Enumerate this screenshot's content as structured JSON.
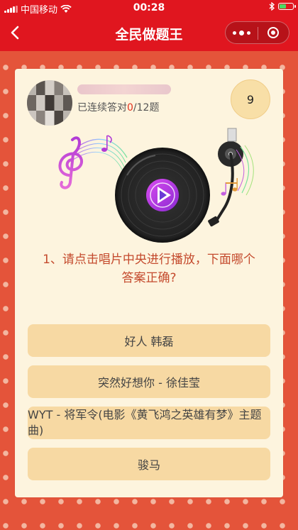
{
  "status_bar": {
    "carrier": "中国移动",
    "time": "00:28",
    "icons": [
      "signal-icon",
      "wifi-icon",
      "bluetooth-icon",
      "battery-icon"
    ]
  },
  "nav": {
    "title": "全民做题王",
    "back_icon": "chevron-left-icon",
    "more_icon": "more-dots-icon",
    "close_icon": "target-close-icon"
  },
  "player": {
    "streak_prefix": "已连续答对",
    "streak_current": "0",
    "streak_total": "/12题",
    "countdown": "9"
  },
  "quiz": {
    "question_line1": "1、请点击唱片中央进行播放，下面哪个",
    "question_line2": "答案正确?",
    "options": [
      {
        "label": "好人 韩磊"
      },
      {
        "label": "突然好想你 - 徐佳莹"
      },
      {
        "label": "WYT - 将军令(电影《黄飞鸿之英雄有梦》主题曲)"
      },
      {
        "label": "骏马"
      }
    ]
  },
  "colors": {
    "brand_red": "#e0161f",
    "frame_orange": "#e4543a",
    "card_bg": "#fdf4de",
    "option_bg": "#f7d9a3",
    "question_text": "#c44a2d"
  }
}
